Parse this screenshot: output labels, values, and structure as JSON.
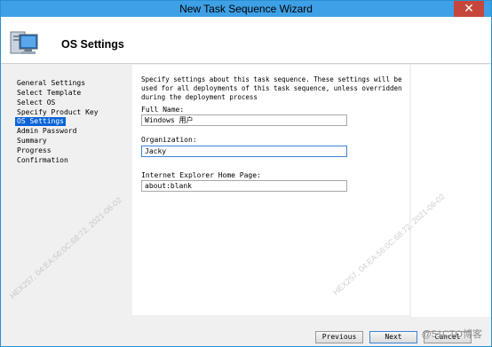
{
  "window": {
    "title": "New Task Sequence Wizard",
    "close_glyph": "✕"
  },
  "header": {
    "title": "OS Settings",
    "icon": "computer-icon"
  },
  "nav": {
    "items": [
      {
        "label": "General Settings",
        "selected": false
      },
      {
        "label": "Select Template",
        "selected": false
      },
      {
        "label": "Select OS",
        "selected": false
      },
      {
        "label": "Specify Product Key",
        "selected": false
      },
      {
        "label": "OS Settings",
        "selected": true
      },
      {
        "label": "Admin Password",
        "selected": false
      },
      {
        "label": "Summary",
        "selected": false
      },
      {
        "label": "Progress",
        "selected": false
      },
      {
        "label": "Confirmation",
        "selected": false
      }
    ]
  },
  "content": {
    "description": "Specify settings about this task sequence.  These settings will be used for all deployments of this task sequence, unless overridden during the deployment process",
    "full_name": {
      "label": "Full Name:",
      "value": "Windows 用户"
    },
    "organization": {
      "label": "Organization:",
      "value": "Jacky"
    },
    "home_page": {
      "label": "Internet Explorer Home Page:",
      "value": "about:blank"
    }
  },
  "buttons": {
    "previous": "Previous",
    "next": "Next",
    "cancel": "Cancel"
  },
  "watermark": {
    "text1": "HEX257, 04:EA:56:0C:68:72, 2021-06-02",
    "text2": "HEX257, 04:EA:56:0C:68:72, 2021-06-02"
  },
  "site_mark": "@51CTO博客"
}
